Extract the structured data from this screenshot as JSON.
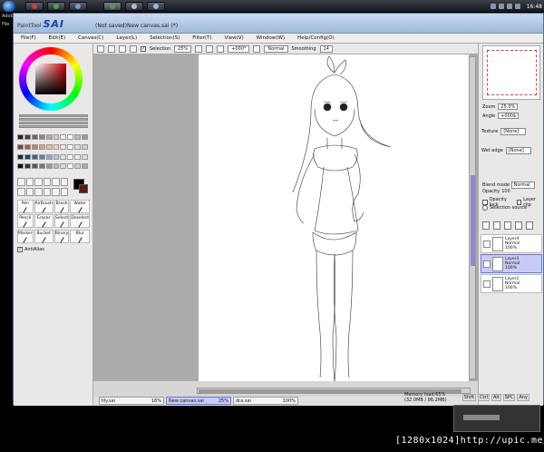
{
  "taskbar": {
    "clock": "16:48",
    "task_colors": [
      "#c9462b",
      "#4aa14a",
      "#6a9fd8",
      "#4aa14a",
      "#bbbbbb",
      "#88c1e8"
    ]
  },
  "background_hint": {
    "line1": "Adobe Photoshop",
    "line2": "File"
  },
  "window": {
    "app_logo_small": "PaintTool",
    "app_logo": "SAI",
    "title": "(Not saved)New canvas.sai (*)",
    "menu": [
      "File(F)",
      "Edit(E)",
      "Canvas(C)",
      "Layer(L)",
      "Selection(S)",
      "Filter(T)",
      "View(V)",
      "Window(W)",
      "Help/Config(O)"
    ]
  },
  "toolbar": {
    "selection_label": "Selection",
    "zoom": "25%",
    "angle": "+000°",
    "blend": "Normal",
    "smoothing_label": "Smoothing",
    "smoothing_value": "14"
  },
  "left_panel": {
    "accent": "#c00000",
    "swatch_colors": [
      "#222",
      "#444",
      "#666",
      "#888",
      "#aaa",
      "#ccc",
      "#eee",
      "#fff",
      "#bbb",
      "#999",
      "#7a4a30",
      "#a06040",
      "#c08060",
      "#d9a080",
      "#e8c0a0",
      "#f0d8c0",
      "#ffe8d0",
      "#ffffff",
      "#ddd",
      "#ccc",
      "#1c2a3a",
      "#2c4060",
      "#40608a",
      "#6080b0",
      "#8aa8d0",
      "#b0c8e8",
      "#d8e4f4",
      "#ffffff",
      "#eee",
      "#ddd",
      "#111",
      "#333",
      "#555",
      "#777",
      "#999",
      "#bbb",
      "#ddd",
      "#fff",
      "#ccc",
      "#aaa"
    ],
    "brushes": [
      "Pen",
      "AirBrush",
      "Brush",
      "Water",
      "Pencil",
      "Eraser",
      "Select",
      "Deselect",
      "Marker",
      "Bucket",
      "Binary",
      "Blur"
    ],
    "antialias": "AntiAlias"
  },
  "right_panel": {
    "zoom_label": "Zoom",
    "zoom_value": "25.0%",
    "angle_label": "Angle",
    "angle_value": "+000$",
    "texture_label": "Texture",
    "texture_value": "[None]",
    "wet_edge_label": "Wet edge",
    "wet_edge_value": "[None]",
    "blend_mode_label": "Blend mode",
    "blend_mode_value": "Normal",
    "opacity_label": "Opacity",
    "opacity_value": "100",
    "opacity_lock": "Opacity lock",
    "layer_clip": "Layer clip",
    "selection_source": "Selection source",
    "layers": [
      {
        "name": "Layer4",
        "mode": "Normal",
        "opacity": "100%",
        "selected": false
      },
      {
        "name": "Layer3",
        "mode": "Normal",
        "opacity": "100%",
        "selected": true
      },
      {
        "name": "Layer1",
        "mode": "Normal",
        "opacity": "100%",
        "selected": false
      }
    ]
  },
  "doc_tabs": [
    {
      "name": "lily.sai",
      "zoom": "16%",
      "active": false
    },
    {
      "name": "New canvas.sai",
      "zoom": "25%",
      "active": true
    },
    {
      "name": "dra.sai",
      "zoom": "100%",
      "active": false
    }
  ],
  "status": {
    "memory": "Memory load:65% (32.0MB / 86.2MB)",
    "keys": [
      "Shift",
      "Ctrl",
      "Alt",
      "SPC",
      "Any"
    ]
  },
  "watermark": "[1280x1024]http://upic.me/"
}
